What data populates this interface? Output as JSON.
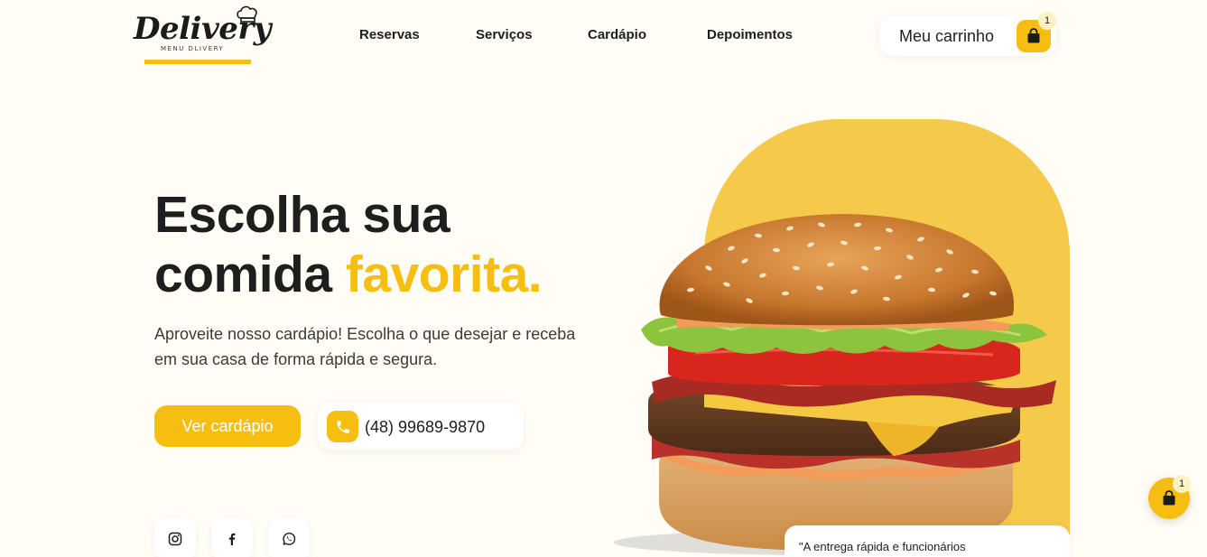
{
  "logo": {
    "script": "Delivery",
    "subtitle": "MENU DLIVERY"
  },
  "nav": {
    "items": [
      {
        "label": "Reservas"
      },
      {
        "label": "Serviços"
      },
      {
        "label": "Cardápio"
      },
      {
        "label": "Depoimentos"
      }
    ]
  },
  "cart": {
    "label": "Meu carrinho",
    "count": "1",
    "icon": "shopping-bag-icon"
  },
  "hero": {
    "title_line1": "Escolha sua",
    "title_line2_plain": "comida",
    "title_line2_accent": "favorita.",
    "description": "Aproveite nosso cardápio! Escolha o que desejar e receba em sua casa de forma rápida e segura.",
    "cta_label": "Ver cardápio",
    "phone": "(48) 99689-9870"
  },
  "social": [
    {
      "name": "instagram-icon"
    },
    {
      "name": "facebook-icon"
    },
    {
      "name": "whatsapp-icon"
    }
  ],
  "testimonial": {
    "text": "\"A entrega rápida e funcionários"
  },
  "floating_cart": {
    "count": "1",
    "icon": "shopping-bag-icon"
  },
  "colors": {
    "accent": "#f7be12",
    "blob": "#f5c94a",
    "background": "#fffdf6",
    "text": "#1e1e1e"
  }
}
